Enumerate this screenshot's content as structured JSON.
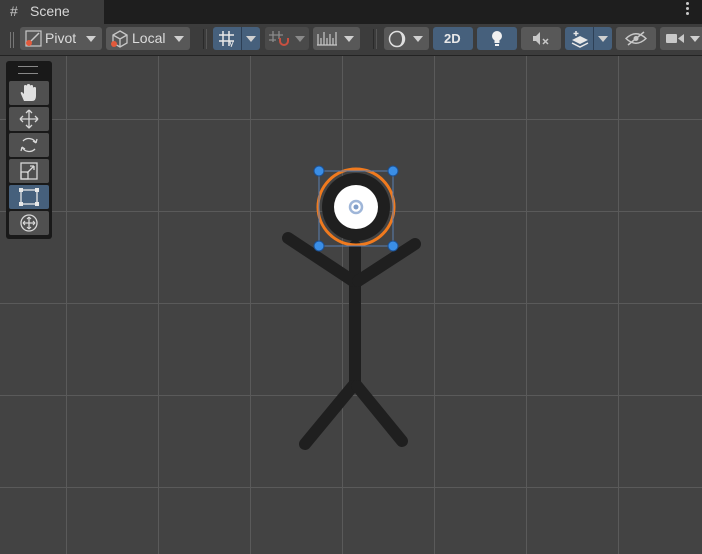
{
  "tab": {
    "title": "Scene",
    "icon": "scene-hash-icon"
  },
  "toolbar": {
    "pivot_label": "Pivot",
    "local_label": "Local",
    "twod_label": "2D"
  },
  "tool_overlay": {
    "tools": [
      {
        "name": "hand-tool",
        "icon": "hand-icon"
      },
      {
        "name": "move-tool",
        "icon": "move-arrows-icon"
      },
      {
        "name": "rotate-tool",
        "icon": "rotate-icon"
      },
      {
        "name": "scale-tool",
        "icon": "scale-icon"
      },
      {
        "name": "rect-tool",
        "icon": "rect-transform-icon",
        "active": true
      },
      {
        "name": "transform-tool",
        "icon": "transform-icon"
      }
    ]
  },
  "colors": {
    "selection_outline": "#f07a1e",
    "handle": "#3a8ee6",
    "active_button": "#46607c",
    "viewport_bg": "#434343",
    "grid_line": "#5a5a5a"
  }
}
